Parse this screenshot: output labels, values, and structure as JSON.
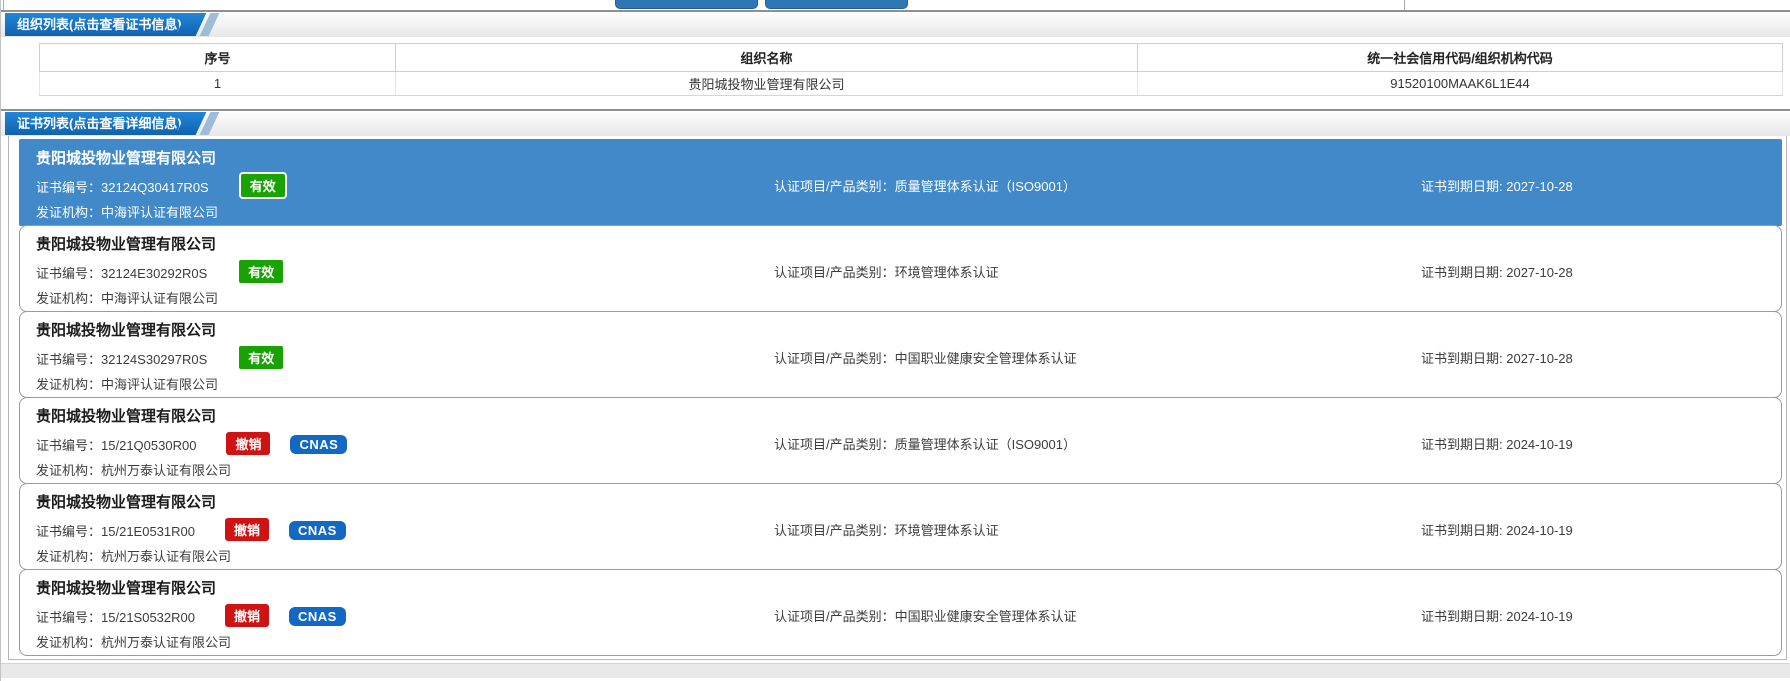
{
  "org_section": {
    "tab_label": "组织列表(点击查看证书信息)",
    "table": {
      "headers": [
        "序号",
        "组织名称",
        "统一社会信用代码/组织机构代码"
      ],
      "rows": [
        {
          "seq": "1",
          "name": "贵阳城投物业管理有限公司",
          "code": "91520100MAAK6L1E44"
        }
      ]
    }
  },
  "cert_section": {
    "tab_label": "证书列表(点击查看详细信息)",
    "labels": {
      "cert_no": "证书编号：",
      "issuer": "发证机构：",
      "category": "认证项目/产品类别：",
      "expiry": "证书到期日期: "
    },
    "items": [
      {
        "company": "贵阳城投物业管理有限公司",
        "cert_no": "32124Q30417R0S",
        "status": "有效",
        "category": "质量管理体系认证（ISO9001）",
        "expiry": "2027-10-28",
        "issuer": "中海评认证有限公司",
        "selected": true
      },
      {
        "company": "贵阳城投物业管理有限公司",
        "cert_no": "32124E30292R0S",
        "status": "有效",
        "category": "环境管理体系认证",
        "expiry": "2027-10-28",
        "issuer": "中海评认证有限公司",
        "selected": false
      },
      {
        "company": "贵阳城投物业管理有限公司",
        "cert_no": "32124S30297R0S",
        "status": "有效",
        "category": "中国职业健康安全管理体系认证",
        "expiry": "2027-10-28",
        "issuer": "中海评认证有限公司",
        "selected": false
      },
      {
        "company": "贵阳城投物业管理有限公司",
        "cert_no": "15/21Q0530R00",
        "status": "撤销",
        "cnas": "CNAS",
        "category": "质量管理体系认证（ISO9001）",
        "expiry": "2024-10-19",
        "issuer": "杭州万泰认证有限公司",
        "selected": false
      },
      {
        "company": "贵阳城投物业管理有限公司",
        "cert_no": "15/21E0531R00",
        "status": "撤销",
        "cnas": "CNAS",
        "category": "环境管理体系认证",
        "expiry": "2024-10-19",
        "issuer": "杭州万泰认证有限公司",
        "selected": false
      },
      {
        "company": "贵阳城投物业管理有限公司",
        "cert_no": "15/21S0532R00",
        "status": "撤销",
        "cnas": "CNAS",
        "category": "中国职业健康安全管理体系认证",
        "expiry": "2024-10-19",
        "issuer": "杭州万泰认证有限公司",
        "selected": false
      }
    ]
  },
  "colors": {
    "selected_card_blue": "#4189c8",
    "tab_blue_top": "#2286d8",
    "tab_blue_bottom": "#0f63ae",
    "valid_green": "#18a303",
    "revoked_red": "#cf1212",
    "cnas_blue": "#1268c2",
    "top_button_blue": "#2e76b5"
  }
}
